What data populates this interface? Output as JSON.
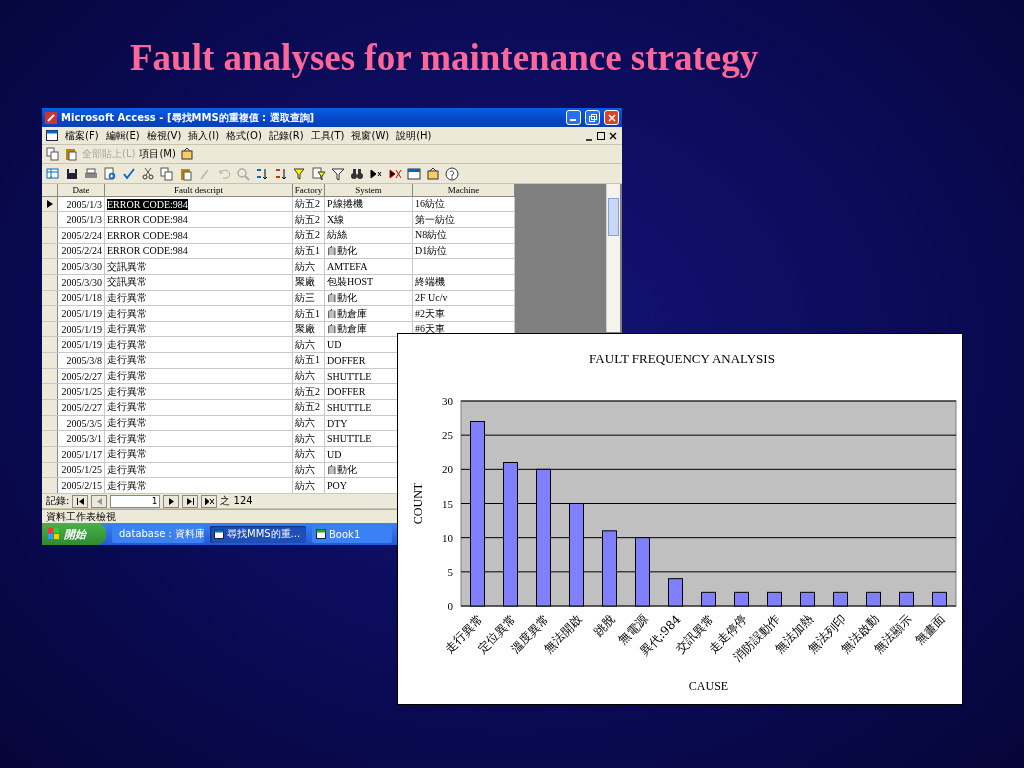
{
  "slide": {
    "title": "Fault analyses for maintenance strategy"
  },
  "access_window": {
    "title": "Microsoft Access - [尋找MMS的重複值 : 選取查詢]",
    "menu": [
      "檔案(F)",
      "編輯(E)",
      "檢視(V)",
      "插入(I)",
      "格式(O)",
      "記錄(R)",
      "工具(T)",
      "視窗(W)",
      "說明(H)"
    ],
    "toolbar_items": [
      {
        "label": "全部貼上(L)",
        "disabled": true
      },
      {
        "label": "項目(M)",
        "disabled": false
      }
    ],
    "datasheet": {
      "columns": [
        "Date",
        "Fault descript",
        "Factory",
        "System",
        "Machine"
      ],
      "rows": [
        {
          "selected": true,
          "date": "2005/1/3",
          "fault": "ERROR CODE:984",
          "factory": "紡五2",
          "system": "P線捲機",
          "machine": "16紡位"
        },
        {
          "selected": false,
          "date": "2005/1/3",
          "fault": "ERROR CODE:984",
          "factory": "紡五2",
          "system": "X線",
          "machine": "第一紡位"
        },
        {
          "selected": false,
          "date": "2005/2/24",
          "fault": "ERROR CODE:984",
          "factory": "紡五2",
          "system": "紡絲",
          "machine": "N8紡位"
        },
        {
          "selected": false,
          "date": "2005/2/24",
          "fault": "ERROR CODE:984",
          "factory": "紡五1",
          "system": "自動化",
          "machine": "D1紡位"
        },
        {
          "selected": false,
          "date": "2005/3/30",
          "fault": "交訊異常",
          "factory": "紡六",
          "system": "AMTEFA"
        },
        {
          "selected": false,
          "date": "2005/3/30",
          "fault": "交訊異常",
          "factory": "聚廠",
          "system": "包裝HOST",
          "machine": "終端機"
        },
        {
          "selected": false,
          "date": "2005/1/18",
          "fault": "走行異常",
          "factory": "紡三",
          "system": "自動化",
          "machine": "2F Uc/v"
        },
        {
          "selected": false,
          "date": "2005/1/19",
          "fault": "走行異常",
          "factory": "紡五1",
          "system": "自動倉庫",
          "machine": "#2天車"
        },
        {
          "selected": false,
          "date": "2005/1/19",
          "fault": "走行異常",
          "factory": "聚廠",
          "system": "自動倉庫",
          "machine": "#6天車"
        },
        {
          "selected": false,
          "date": "2005/1/19",
          "fault": "走行異常",
          "factory": "紡六",
          "system": "UD"
        },
        {
          "selected": false,
          "date": "2005/3/8",
          "fault": "走行異常",
          "factory": "紡五1",
          "system": "DOFFER"
        },
        {
          "selected": false,
          "date": "2005/2/27",
          "fault": "走行異常",
          "factory": "紡六",
          "system": "SHUTTLE"
        },
        {
          "selected": false,
          "date": "2005/1/25",
          "fault": "走行異常",
          "factory": "紡五2",
          "system": "DOFFER"
        },
        {
          "selected": false,
          "date": "2005/2/27",
          "fault": "走行異常",
          "factory": "紡五2",
          "system": "SHUTTLE"
        },
        {
          "selected": false,
          "date": "2005/3/5",
          "fault": "走行異常",
          "factory": "紡六",
          "system": "DTY"
        },
        {
          "selected": false,
          "date": "2005/3/1",
          "fault": "走行異常",
          "factory": "紡六",
          "system": "SHUTTLE"
        },
        {
          "selected": false,
          "date": "2005/1/17",
          "fault": "走行異常",
          "factory": "紡六",
          "system": "UD"
        },
        {
          "selected": false,
          "date": "2005/1/25",
          "fault": "走行異常",
          "factory": "紡六",
          "system": "自動化"
        },
        {
          "selected": false,
          "date": "2005/2/15",
          "fault": "走行異常",
          "factory": "紡六",
          "system": "POY"
        }
      ]
    },
    "record_nav": {
      "label": "記錄:",
      "current": "1",
      "total": "之 124"
    },
    "status_bar": "資料工作表檢視"
  },
  "taskbar": {
    "start": "開始",
    "items": [
      {
        "label": "database : 資料庫",
        "selected": false
      },
      {
        "label": "尋找MMS的重...",
        "selected": true
      },
      {
        "label": "Book1",
        "selected": false
      }
    ]
  },
  "chart": {
    "chart_data": {
      "type": "bar",
      "title": "FAULT FREQUENCY ANALYSIS",
      "xlabel": "CAUSE",
      "ylabel": "COUNT",
      "categories": [
        "走行異常",
        "定位異常",
        "溫度異常",
        "無法開啟",
        "跳脫",
        "無電源",
        "異代:984",
        "交訊異常",
        "走走停停",
        "消防誤動作",
        "無法加熱",
        "無法列印",
        "無法啟動",
        "無法顯示",
        "無畫面"
      ],
      "grid": true,
      "series": [
        {
          "color": "#8080ff",
          "values": [
            27,
            21,
            20,
            15,
            11,
            10,
            4,
            2,
            2,
            2,
            2,
            2,
            2,
            2,
            2
          ]
        }
      ],
      "ylim": [
        0,
        30
      ],
      "yticks": [
        0,
        5,
        10,
        15,
        20,
        25,
        30
      ]
    }
  }
}
